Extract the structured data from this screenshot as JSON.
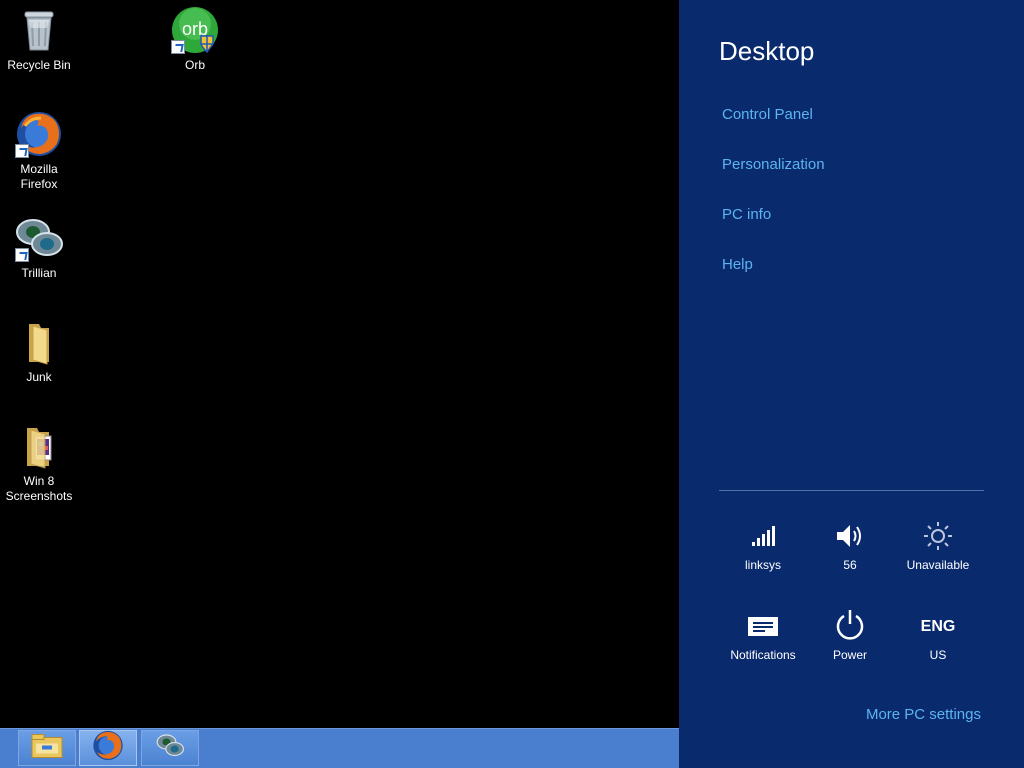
{
  "desktop": {
    "icons": [
      {
        "label": "Recycle Bin",
        "icon": "recycle-bin-icon"
      },
      {
        "label": "Orb",
        "icon": "orb-icon",
        "badge_text": "orb"
      },
      {
        "label": "Mozilla Firefox",
        "icon": "firefox-icon"
      },
      {
        "label": "Trillian",
        "icon": "trillian-icon"
      },
      {
        "label": "Junk",
        "icon": "folder-icon"
      },
      {
        "label": "Win 8 Screenshots",
        "icon": "folder-images-icon"
      }
    ]
  },
  "taskbar": {
    "buttons": [
      {
        "name": "File Explorer",
        "icon": "file-explorer-icon"
      },
      {
        "name": "Mozilla Firefox",
        "icon": "firefox-icon"
      },
      {
        "name": "Trillian",
        "icon": "trillian-icon"
      }
    ]
  },
  "settings_pane": {
    "title": "Desktop",
    "links": [
      "Control Panel",
      "Personalization",
      "PC info",
      "Help"
    ],
    "quick_settings": [
      {
        "label": "linksys",
        "icon": "wifi-signal-icon"
      },
      {
        "label": "56",
        "icon": "volume-icon"
      },
      {
        "label": "Unavailable",
        "icon": "brightness-icon"
      },
      {
        "label": "Notifications",
        "icon": "notifications-icon"
      },
      {
        "label": "Power",
        "icon": "power-icon"
      },
      {
        "label": "US",
        "icon_text": "ENG"
      }
    ],
    "more_settings": "More PC settings"
  },
  "colors": {
    "pane_bg": "#0a2a6e",
    "link": "#5cb4ef",
    "taskbar": "#4a7fcf"
  }
}
